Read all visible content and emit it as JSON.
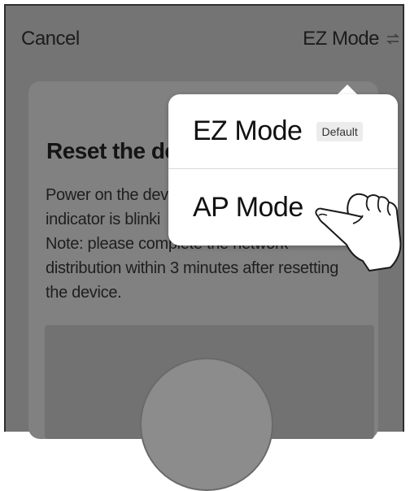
{
  "header": {
    "cancel_label": "Cancel",
    "mode_label": "EZ Mode",
    "mode_icon": "switch-arrows-icon"
  },
  "card": {
    "title": "Reset the de",
    "body_lines": [
      "Power on the dev",
      "indicator is blinki",
      "Note: please complete the network",
      "distribution within 3 minutes after resetting",
      "the device."
    ]
  },
  "mode_menu": {
    "items": [
      {
        "label": "EZ Mode",
        "badge": "Default"
      },
      {
        "label": "AP Mode"
      }
    ],
    "pointer_icon": "pointing-hand-icon"
  },
  "colors": {
    "overlay": "#747474",
    "popover": "#ffffff",
    "badge_bg": "#ececec"
  }
}
